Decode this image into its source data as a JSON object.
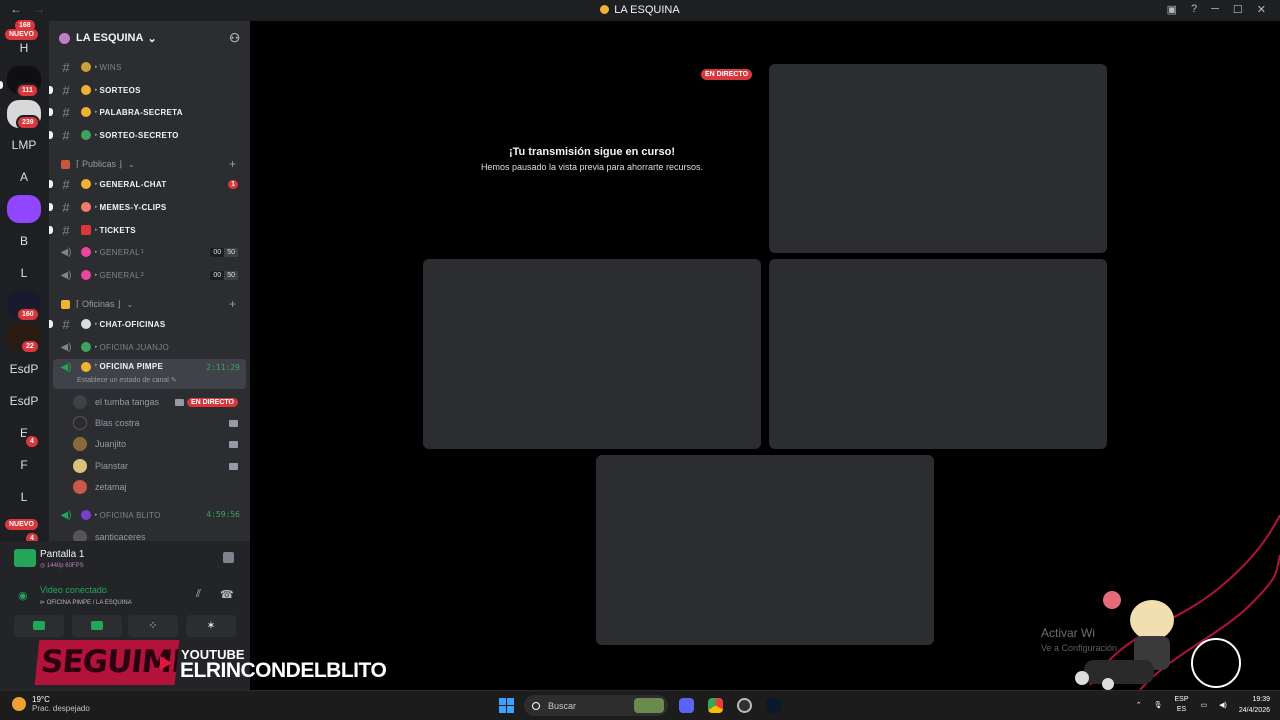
{
  "window": {
    "title": "LA ESQUINA",
    "nav_back": "←",
    "nav_forward": "→"
  },
  "rail": {
    "items": [
      {
        "label": "H"
      },
      {
        "label": "LMP"
      },
      {
        "label": "A"
      },
      {
        "label": "B"
      },
      {
        "label": "L"
      },
      {
        "label": "EsdP"
      },
      {
        "label": "EsdP"
      },
      {
        "label": "E"
      },
      {
        "label": "F"
      },
      {
        "label": "L"
      }
    ],
    "badges": {
      "top": "168",
      "b111": "111",
      "b239": "239",
      "b160": "160",
      "b22": "22",
      "e": "4",
      "bottom": "4"
    },
    "nuevo": "NUEVO"
  },
  "guild": {
    "name": "LA ESQUINA",
    "chevron": "⌄"
  },
  "channels": {
    "top": [
      {
        "name": "WINS",
        "emoji_color": "#c9a23c"
      },
      {
        "name": "SORTEOS",
        "emoji_color": "#f0b232"
      },
      {
        "name": "PALABRA-SECRETA",
        "emoji_color": "#f0b232"
      },
      {
        "name": "SORTEO-SECRETO",
        "emoji_color": "#3ba55d"
      }
    ],
    "cat_publicas": "⌈ Publicas ⌋",
    "publicas": [
      {
        "name": "GENERAL-CHAT",
        "emoji_color": "#f0b232",
        "badge": "1"
      },
      {
        "name": "MEMES-Y-CLIPS",
        "emoji_color": "#f47b67"
      },
      {
        "name": "TICKETS",
        "emoji_color": "#da373c"
      },
      {
        "name": "GENERAL",
        "sup": "1",
        "emoji_color": "#eb459e",
        "count_left": "00",
        "count_right": "50"
      },
      {
        "name": "GENERAL",
        "sup": "2",
        "emoji_color": "#eb459e",
        "count_left": "00",
        "count_right": "50"
      }
    ],
    "cat_oficinas": "⌈ Oficinas ⌋",
    "oficinas": [
      {
        "name": "CHAT-OFICINAS",
        "emoji_color": "#dbdee1"
      },
      {
        "name": "OFICINA JUANJO",
        "emoji_color": "#3ba55d"
      }
    ],
    "active": {
      "name": "OFICINA PIMPE",
      "timer": "2:11:29",
      "status": "Establece un estado de canal ✎"
    },
    "users": [
      {
        "name": "el tumba tangas",
        "live": "EN DIRECTO"
      },
      {
        "name": "Blas costra"
      },
      {
        "name": "Juanjito"
      },
      {
        "name": "Pianstar"
      },
      {
        "name": "zetamaj"
      }
    ],
    "blito": {
      "name": "OFICINA BLITO",
      "timer": "4:59:56"
    },
    "partial_user": "santicaceres"
  },
  "voice_panel": {
    "share_title": "Pantalla 1",
    "share_sub": "◎ 1440p 60FPS",
    "connected": "Video conectado",
    "connected_sub": "⊳ OFICINA PIMPE / LA ESQUINA"
  },
  "stage": {
    "live_badge": "EN DIRECTO",
    "paused_title": "¡Tu transmisión sigue en curso!",
    "paused_sub": "Hemos pausado la vista previa para ahorrarte recursos.",
    "activate": "Activar Wi",
    "activate_sub": "Ve a Configuración"
  },
  "promo": {
    "follow": "SEGUIME EN",
    "platform": "YOUTUBE",
    "channel": "ELRINCONDELBLITO"
  },
  "taskbar": {
    "temp": "19°C",
    "weather": "Prac. despejado",
    "search": "Buscar",
    "lang_top": "ESP",
    "lang_bottom": "ES",
    "time": "19:39",
    "date": "24/4/2026"
  },
  "colors": {
    "accent_red": "#da373c",
    "voice_green": "#23a55a",
    "bg_channels": "#2b2d31",
    "bg_rail": "#1e1f22"
  }
}
